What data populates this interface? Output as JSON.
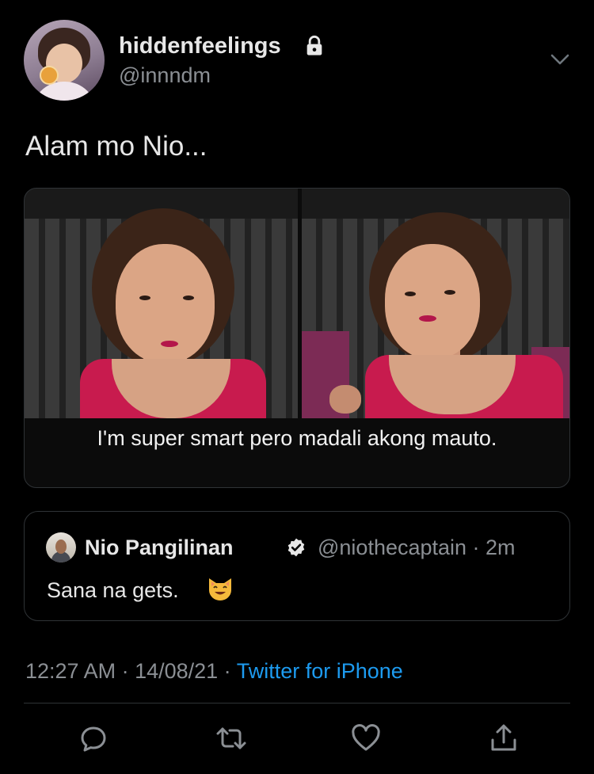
{
  "author": {
    "display_name": "hiddenfeelings",
    "handle": "@innndm",
    "protected_icon": "lock-icon"
  },
  "menu_icon": "chevron-down-icon",
  "tweet": {
    "text": "Alam mo Nio...",
    "media": {
      "caption": "I'm super smart pero madali akong mauto."
    }
  },
  "quoted_tweet": {
    "display_name": "Nio Pangilinan",
    "verified_icon": "verified-badge-icon",
    "handle_time": "@niothecaptain · 2m",
    "text": "Sana na gets.",
    "emoji": "smiling-cat-emoji"
  },
  "meta": {
    "time_date": "12:27 AM · 14/08/21 · ",
    "source": "Twitter for iPhone"
  },
  "actions": [
    "reply-icon",
    "retweet-icon",
    "like-icon",
    "share-icon"
  ],
  "colors": {
    "background": "#000000",
    "accent": "#1d9bf0",
    "muted": "#8b8f94"
  }
}
